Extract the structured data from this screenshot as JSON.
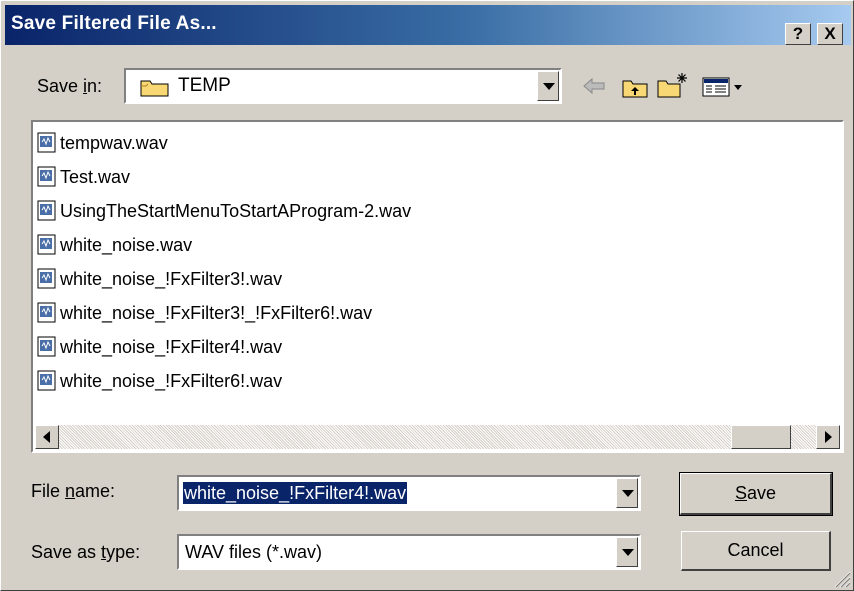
{
  "window": {
    "title": "Save Filtered File As...",
    "help_label": "?",
    "close_label": "X"
  },
  "save_in": {
    "label_pre": "Save ",
    "label_accel": "i",
    "label_post": "n:",
    "value": "TEMP"
  },
  "toolbar": {
    "back_icon": "back-arrow-icon",
    "up_icon": "up-folder-icon",
    "new_folder_icon": "new-folder-icon",
    "view_icon": "view-menu-icon"
  },
  "files": [
    "tempwav.wav",
    "Test.wav",
    "UsingTheStartMenuToStartAProgram-2.wav",
    "white_noise.wav",
    "white_noise_!FxFilter3!.wav",
    "white_noise_!FxFilter3!_!FxFilter6!.wav",
    "white_noise_!FxFilter4!.wav",
    "white_noise_!FxFilter6!.wav"
  ],
  "file_name": {
    "label_pre": "File ",
    "label_accel": "n",
    "label_post": "ame:",
    "value": "white_noise_!FxFilter4!.wav"
  },
  "save_type": {
    "label_pre": "Save as ",
    "label_accel": "t",
    "label_post": "ype:",
    "value": "WAV files (*.wav)"
  },
  "buttons": {
    "save_accel": "S",
    "save_rest": "ave",
    "cancel": "Cancel"
  },
  "colors": {
    "title_start": "#0a246a",
    "title_end": "#a6caf0",
    "face": "#d4d0c8",
    "selection": "#0a246a"
  }
}
